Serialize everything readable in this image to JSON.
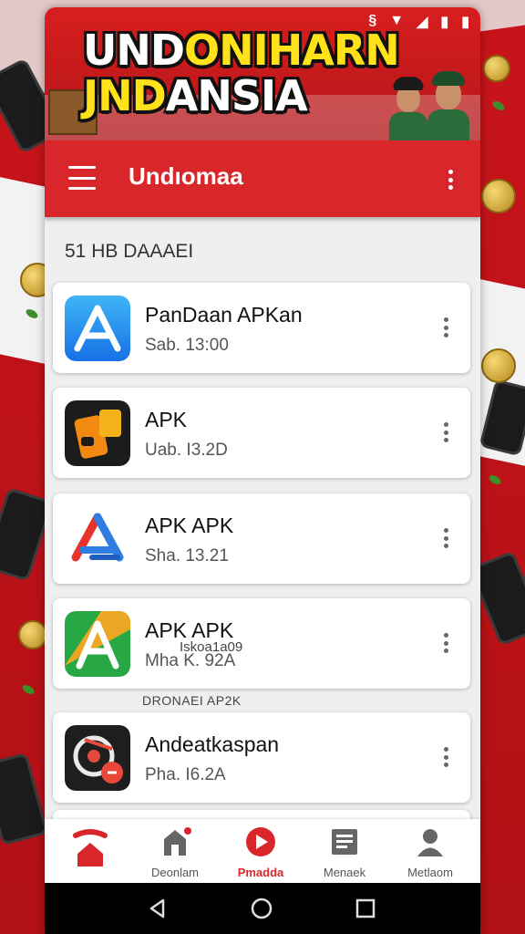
{
  "banner": {
    "title_line1_a": "UND",
    "title_line1_b": "ONIHARN",
    "title_line2_a": "JND",
    "title_line2_b": "ANSIA"
  },
  "app_bar": {
    "title": "Undıomaa"
  },
  "section_header": "51 HB DAAAEI",
  "apps": [
    {
      "name": "PanDaan APKan",
      "meta": "Sab. 13:00",
      "icon": "app-store-a-icon"
    },
    {
      "name": "APK",
      "meta": "Uab. I3.2D",
      "icon": "orange-phone-icon"
    },
    {
      "name": "APK APK",
      "meta": "Sha. 13.21",
      "icon": "triangle-a-icon"
    },
    {
      "name": "APK APK",
      "meta": "Mha K. 92A",
      "icon": "green-a-icon"
    },
    {
      "name": "Andeatkaspan",
      "meta": "Pha. I6.2A",
      "icon": "disc-icon"
    }
  ],
  "overlap_text": "Iskoa1a09",
  "between_text": "DRONAEI AP2K",
  "bottom_nav": [
    {
      "label": "",
      "icon": "home-icon",
      "active": true
    },
    {
      "label": "Deonlam",
      "icon": "store-icon",
      "active": false
    },
    {
      "label": "Pmadda",
      "icon": "play-icon",
      "active": true
    },
    {
      "label": "Menaek",
      "icon": "document-icon",
      "active": false
    },
    {
      "label": "Metlaom",
      "icon": "person-icon",
      "active": false
    }
  ],
  "colors": {
    "brand_red": "#d9262a",
    "banner_yellow": "#ffe21a",
    "card_bg": "#ffffff",
    "screen_bg": "#efefef"
  }
}
